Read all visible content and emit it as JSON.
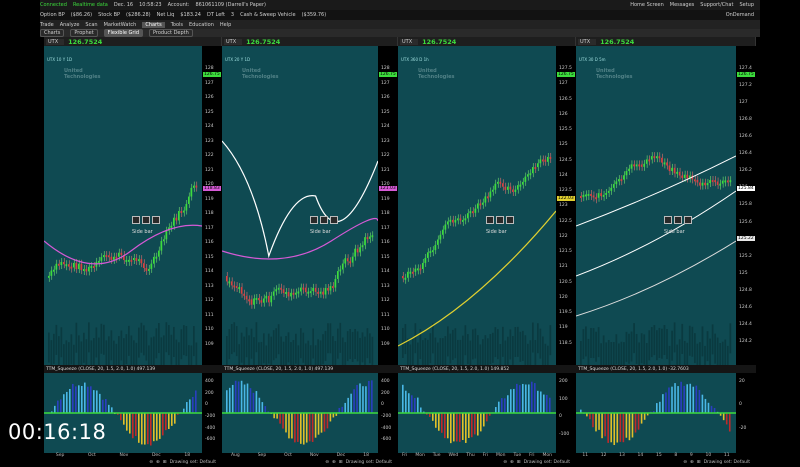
{
  "status": {
    "connected": "Connected",
    "realtime": "Realtime data",
    "date": "Dec. 16",
    "time": "10:58:23",
    "account_label": "Account:",
    "account": "861061109 (Darrell's Paper)",
    "home": "Home Screen",
    "messages": "Messages",
    "support": "Support/Chat",
    "setup": "Setup"
  },
  "account_bar": {
    "items": [
      "Option BP",
      "($86.26)",
      "Stock BP",
      "($286.28)",
      "Net Liq",
      "$183.24",
      "DT Left",
      "3",
      "Cash & Sweep Vehicle",
      "($359.76)"
    ],
    "ondemand": "OnDemand"
  },
  "tabs": [
    "Trade",
    "Analyze",
    "Scan",
    "MarketWatch",
    "Charts",
    "Tools",
    "Education",
    "Help"
  ],
  "subtabs": [
    "Charts",
    "Prophet",
    "Flexible Grid",
    "Product Depth"
  ],
  "charts": [
    {
      "symbol": "UTX",
      "price": "126.7524",
      "info": "UTX 10 Y 1D",
      "info2": "D: 12/18/17  O: 127.04  H: 127.50  L: 126.27",
      "company": "United Technologies",
      "tag_price": "126.75",
      "tag_ma": "118.83",
      "yticks": [
        "128",
        "127",
        "126",
        "125",
        "124",
        "123",
        "122",
        "121",
        "120",
        "119",
        "118",
        "117",
        "116",
        "115",
        "114",
        "113",
        "112",
        "111",
        "110",
        "109"
      ],
      "study": "TTM_Squeeze (CLOSE, 20, 1.5, 2.0, 1.0)   497.139",
      "lower_ticks": [
        "400",
        "200",
        "0",
        "-200",
        "-400",
        "-600"
      ],
      "xlabels": [
        "Sep",
        "Oct",
        "Nov",
        "Dec",
        "18"
      ]
    },
    {
      "symbol": "UTX",
      "price": "126.7524",
      "info": "UTX 20 Y 1D",
      "info2": "D: 12/18/17  O: 126.74  H: 127.50  L: 126.27",
      "company": "United Technologies",
      "tag_price": "126.75",
      "tag_ma": "121.03",
      "yticks": [
        "128",
        "127",
        "126",
        "125",
        "124",
        "123",
        "122",
        "121",
        "120",
        "119",
        "118",
        "117",
        "116",
        "115",
        "114",
        "113",
        "112",
        "111",
        "110",
        "109"
      ],
      "study": "TTM_Squeeze (CLOSE, 20, 1.5, 2.0, 1.0)   497.139",
      "lower_ticks": [
        "400",
        "200",
        "0",
        "-200",
        "-400",
        "-600"
      ],
      "xlabels": [
        "Aug",
        "Sep",
        "Oct",
        "Nov",
        "Dec",
        "18"
      ]
    },
    {
      "symbol": "UTX",
      "price": "126.7524",
      "info": "UTX 360 D 1h",
      "info2": "D: 12/18/17 10:00 AM  O: 126.69  H: 126.75",
      "company": "United Technologies",
      "tag_price": "126.75",
      "tag_ma": "122.03",
      "yticks": [
        "127.5",
        "127",
        "126.5",
        "126",
        "125.5",
        "125",
        "124.5",
        "124",
        "123.5",
        "123",
        "122.5",
        "122",
        "121.5",
        "121",
        "120.5",
        "120",
        "119.5",
        "119",
        "118.5"
      ],
      "study": "TTM_Squeeze (CLOSE, 20, 1.5, 2.0, 1.0)   149.852",
      "lower_ticks": [
        "200",
        "100",
        "0",
        "-100"
      ],
      "xlabels": [
        "Fri",
        "Mon",
        "Tue",
        "Wed",
        "Thu",
        "Fri",
        "Mon",
        "Tue",
        "Fri",
        "Mon"
      ]
    },
    {
      "symbol": "UTX",
      "price": "126.7524",
      "info": "UTX 30 D 5m",
      "info2": "D: 12/18/17 10:55 AM  O: 126.69  H: 126.80",
      "company": "United Technologies",
      "tag_price": "126.75",
      "tag_ma": "125.84",
      "tag_low": "125.22",
      "yticks": [
        "127.4",
        "127.2",
        "127",
        "126.8",
        "126.6",
        "126.4",
        "126.2",
        "126",
        "125.8",
        "125.6",
        "125.4",
        "125.2",
        "125",
        "124.8",
        "124.6",
        "124.4",
        "124.2"
      ],
      "study": "TTM_Squeeze (CLOSE, 20, 1.5, 2.0, 1.0)   -32.7603",
      "lower_ticks": [
        "20",
        "0",
        "-20"
      ],
      "xlabels": [
        "11",
        "12",
        "13",
        "14",
        "15",
        "8",
        "9",
        "10",
        "11"
      ]
    }
  ],
  "drawing_set": "Drawing set: Default",
  "sidebar_label": "Side bar",
  "timer": "00:16:18",
  "colors": {
    "plot_bg": "#0f4a52",
    "price_green": "#3ddc3d",
    "ma_magenta": "#d65ad6"
  }
}
